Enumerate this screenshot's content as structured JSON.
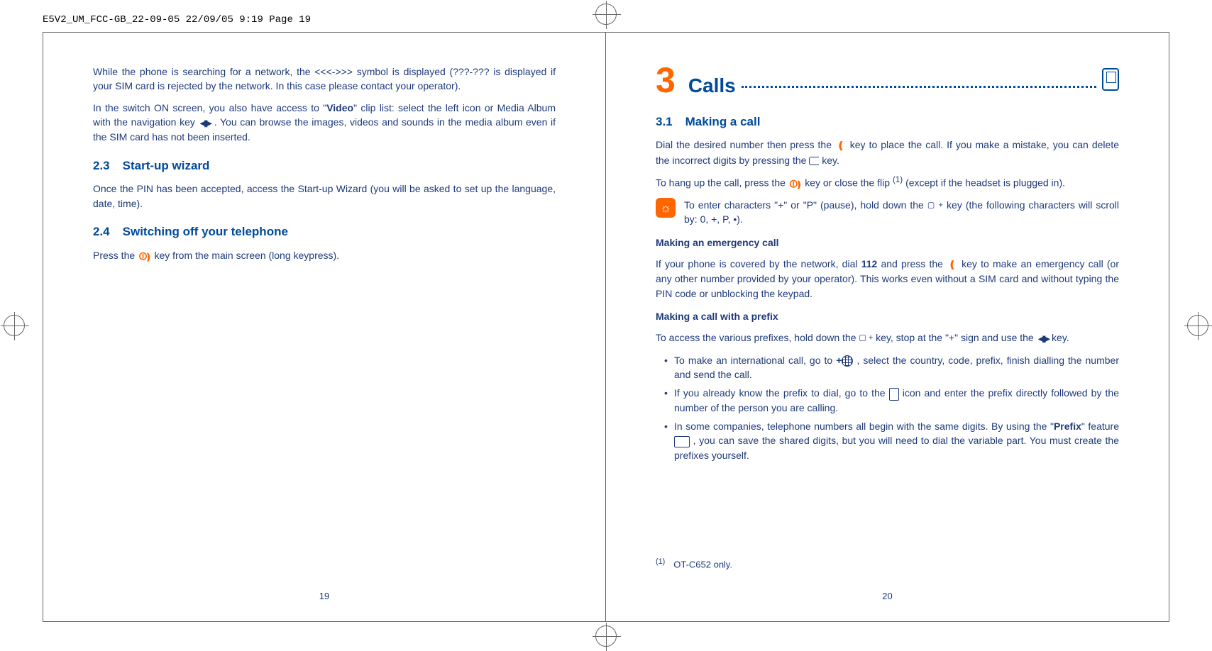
{
  "header": "E5V2_UM_FCC-GB_22-09-05  22/09/05  9:19  Page 19",
  "left": {
    "p1a": "While the phone is searching for a network, the <<<->>> symbol is displayed (",
    "p1b": "???-???",
    "p1c": " is displayed if your SIM card is rejected by the network. In this case please contact your operator).",
    "p2a": "In the switch ON screen, you also have access to \"",
    "p2bold": "Video",
    "p2b": "\" clip list: select the left icon or Media Album with the navigation key ",
    "p2c": ". You can browse the images, videos and sounds in the media album even if the SIM card has not been inserted.",
    "s23_num": "2.3",
    "s23_title": "Start-up wizard",
    "p3": "Once the PIN has been accepted, access the Start-up Wizard (you will be asked to set up the language, date, time).",
    "s24_num": "2.4",
    "s24_title": "Switching off your telephone",
    "p4a": "Press the ",
    "p4b": " key from the main screen (long keypress).",
    "pagenum": "19"
  },
  "right": {
    "chapter_num": "3",
    "chapter_title": "Calls",
    "s31_num": "3.1",
    "s31_title": "Making a call",
    "p1a": "Dial the desired number then press the ",
    "p1b": " key to place the call. If you make a mistake, you can delete the incorrect digits by pressing the ",
    "p1c": " key.",
    "p2a": "To hang up the call, press the ",
    "p2b": " key or close the flip ",
    "p2sup": "(1)",
    "p2c": " (except if the headset is plugged in).",
    "tip_a": "To enter characters \"+\" or \"P\" (pause), hold down the ",
    "tip_b": " key (the following characters will scroll by: 0, +, P, •).",
    "sub1": "Making an emergency call",
    "p3a": "If your phone is covered by the network, dial ",
    "p3bold": "112",
    "p3b": " and press the ",
    "p3c": " key to make an emergency call (or any other number provided by your operator). This works even without a SIM card and without typing the PIN code or unblocking the keypad.",
    "sub2": "Making a call with a prefix",
    "p4a": "To access the various prefixes, hold down the ",
    "p4b": " key, stop at the \"+\" sign and use the ",
    "p4c": " key.",
    "li1a": "To make an international call, go to ",
    "li1plus": "+",
    "li1b": ", select the country, code, prefix, finish dialling the number and send the call.",
    "li2a": "If you already know the prefix to dial, go to the ",
    "li2b": " icon and enter the prefix directly followed by the number of the person you are calling.",
    "li3a": "In some companies, telephone numbers all begin with the same digits. By using the \"",
    "li3bold": "Prefix",
    "li3b": "\" feature ",
    "li3c": ", you can save the shared digits, but you will need to dial the variable part. You must create the prefixes yourself.",
    "footnote_sup": "(1)",
    "footnote": "OT-C652 only.",
    "pagenum": "20"
  }
}
